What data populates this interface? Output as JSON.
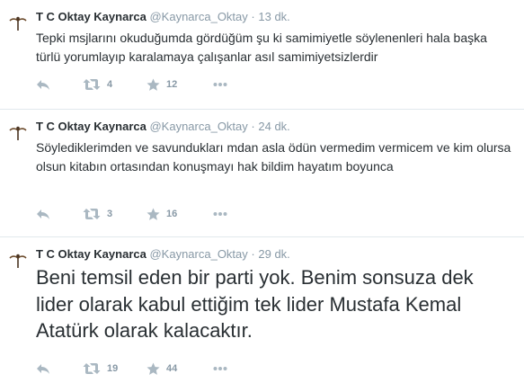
{
  "tweets": [
    {
      "name": "T C Oktay Kaynarca",
      "handle": "@Kaynarca_Oktay",
      "separator": "·",
      "time": "13 dk.",
      "text": "Tepki msjlarını okuduğumda gördüğüm şu ki samimiyetle söylenenleri hala başka türlü yorumlayıp karalamaya çalışanlar asıl samimiyetsizlerdir",
      "retweets": "4",
      "favorites": "12"
    },
    {
      "name": "T C Oktay Kaynarca",
      "handle": "@Kaynarca_Oktay",
      "separator": "·",
      "time": "24 dk.",
      "text": "Söylediklerimden ve savundukları mdan asla ödün vermedim vermicem ve kim olursa olsun kitabın ortasından konuşmayı hak bildim hayatım boyunca",
      "retweets": "3",
      "favorites": "16"
    },
    {
      "name": "T C Oktay Kaynarca",
      "handle": "@Kaynarca_Oktay",
      "separator": "·",
      "time": "29 dk.",
      "text": "Beni temsil eden bir parti yok. Benim sonsuza dek  lider olarak kabul ettiğim tek lider Mustafa Kemal Atatürk olarak kalacaktır.",
      "retweets": "19",
      "favorites": "44"
    }
  ],
  "colors": {
    "text": "#292f33",
    "meta": "#8899a6",
    "icon": "#aab8c2",
    "divider": "#e1e8ed"
  }
}
